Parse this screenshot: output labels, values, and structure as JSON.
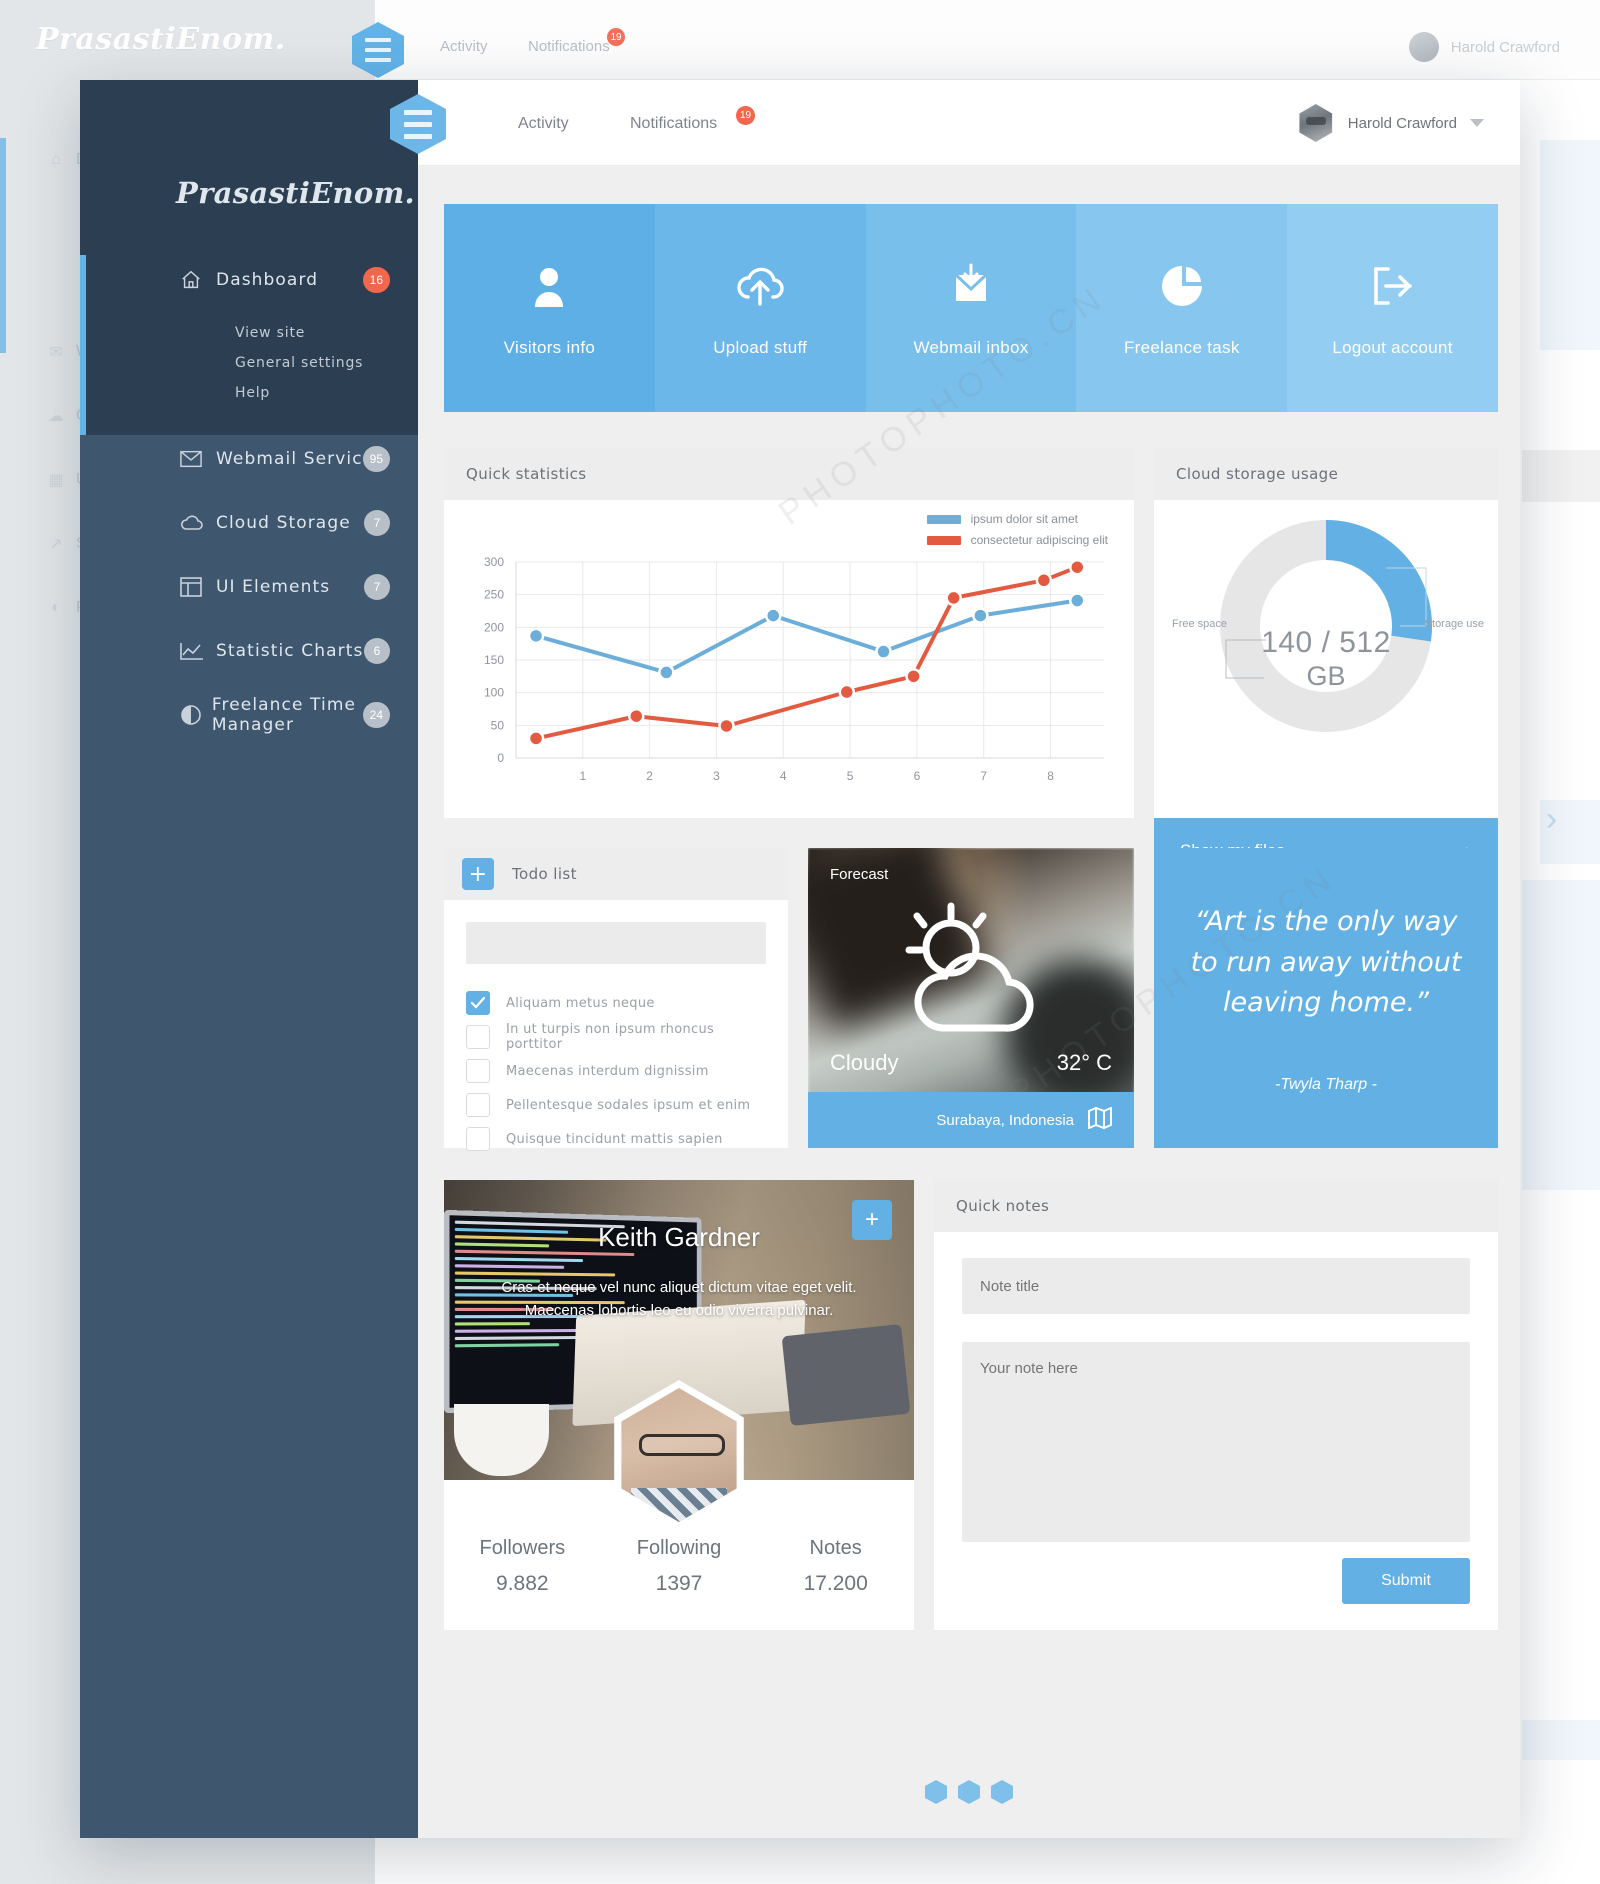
{
  "brand": {
    "logo": "PrasastiEnom."
  },
  "topbar": {
    "menu_toggle_icon": "hamburger-icon",
    "links": [
      {
        "label": "Activity",
        "badge": null
      },
      {
        "label": "Notifications",
        "badge": "19"
      }
    ],
    "user": {
      "name": "Harold Crawford",
      "caret_icon": "chevron-down-icon"
    }
  },
  "sidebar": {
    "items": [
      {
        "label": "Dashboard",
        "icon": "home-icon",
        "badge": "16",
        "badge_accent": true
      },
      {
        "label": "Webmail Service",
        "icon": "envelope-icon",
        "badge": "95",
        "badge_accent": false
      },
      {
        "label": "Cloud Storage",
        "icon": "cloud-icon",
        "badge": "7",
        "badge_accent": false
      },
      {
        "label": "UI Elements",
        "icon": "window-icon",
        "badge": "7",
        "badge_accent": false
      },
      {
        "label": "Statistic Charts",
        "icon": "line-chart-icon",
        "badge": "6",
        "badge_accent": false
      },
      {
        "label": "Freelance Time Manager",
        "icon": "pie-chart-icon",
        "badge": "24",
        "badge_accent": false
      }
    ],
    "sub_items": [
      {
        "label": "View site"
      },
      {
        "label": "General settings"
      },
      {
        "label": "Help"
      }
    ]
  },
  "tiles": [
    {
      "label": "Visitors info",
      "icon": "user-icon",
      "color": "#5dafe6"
    },
    {
      "label": "Upload stuff",
      "icon": "cloud-upload-icon",
      "color": "#6cb7e9"
    },
    {
      "label": "Webmail inbox",
      "icon": "mail-download-icon",
      "color": "#79bfec"
    },
    {
      "label": "Freelance task",
      "icon": "pie-chart-icon",
      "color": "#87c7ef"
    },
    {
      "label": "Logout account",
      "icon": "logout-icon",
      "color": "#93cdf1"
    }
  ],
  "quick_statistics": {
    "title": "Quick statistics"
  },
  "cloud_storage": {
    "title": "Cloud storage usage",
    "used_label": "140 / 512",
    "unit": "GB",
    "free_space_label": "Free space",
    "storage_use_label": "Storage use",
    "cta": "Show my files",
    "cta_icon": "chevron-right-icon"
  },
  "todo": {
    "title": "Todo list",
    "add_icon": "plus-icon",
    "input_value": "",
    "input_placeholder": "",
    "items": [
      {
        "text": "Aliquam metus neque",
        "done": true
      },
      {
        "text": "In ut turpis non ipsum rhoncus porttitor",
        "done": false
      },
      {
        "text": "Maecenas interdum dignissim",
        "done": false
      },
      {
        "text": "Pellentesque sodales ipsum et enim",
        "done": false
      },
      {
        "text": "Quisque tincidunt mattis sapien",
        "done": false
      }
    ]
  },
  "weather": {
    "label": "Forecast",
    "condition": "Cloudy",
    "temperature": "32° C",
    "location": "Surabaya, Indonesia",
    "map_icon": "map-icon",
    "icon": "sun-behind-cloud-icon"
  },
  "quote": {
    "text": "“Art is the only way to run away without leaving home.”",
    "author": "-Twyla Tharp -"
  },
  "profile": {
    "name": "Keith Gardner",
    "description": "Cras et neque vel nunc aliquet dictum vitae eget velit. Maecenas lobortis leo eu odio viverra pulvinar.",
    "add_icon": "plus-icon",
    "stats": [
      {
        "key": "Followers",
        "value": "9.882"
      },
      {
        "key": "Following",
        "value": "1397"
      },
      {
        "key": "Notes",
        "value": "17.200"
      }
    ]
  },
  "quick_notes": {
    "title": "Quick notes",
    "title_input_value": "",
    "title_placeholder": "Note title",
    "body_value": "",
    "body_placeholder": "Your note here",
    "submit_label": "Submit"
  },
  "pager": {
    "dots": 3,
    "active": 0
  },
  "colors": {
    "accent": "#62b0e4",
    "sidebar_dark": "#2c3e52",
    "sidebar": "#3f566f",
    "danger": "#f2674c",
    "series_blue": "#6caed9",
    "series_red": "#e25b41"
  },
  "chart_data": {
    "type": "line",
    "title": "Quick statistics",
    "xlabel": "",
    "ylabel": "",
    "x": [
      1,
      2,
      3,
      4,
      5,
      6,
      7,
      8
    ],
    "xticks": [
      "1",
      "2",
      "3",
      "4",
      "5",
      "6",
      "7",
      "8"
    ],
    "yticks": [
      "0",
      "50",
      "100",
      "150",
      "200",
      "250",
      "300"
    ],
    "ylim": [
      0,
      300
    ],
    "grid": true,
    "legend_position": "top-right",
    "series": [
      {
        "name": "ipsum dolor sit amet",
        "color": "#6caed9",
        "values": [
          187,
          131,
          null,
          218,
          null,
          163,
          218,
          241
        ]
      },
      {
        "name": "consectetur adipiscing elit",
        "color": "#e25b41",
        "values": [
          30,
          64,
          49,
          null,
          101,
          125,
          245,
          272
        ]
      }
    ],
    "series_points": [
      {
        "name": "ipsum dolor sit amet",
        "color": "#6caed9",
        "points": [
          [
            0.3,
            187
          ],
          [
            2.25,
            131
          ],
          [
            3.85,
            218
          ],
          [
            5.5,
            163
          ],
          [
            6.95,
            218
          ],
          [
            8.4,
            241
          ]
        ]
      },
      {
        "name": "consectetur adipiscing elit",
        "color": "#e25b41",
        "points": [
          [
            0.3,
            30
          ],
          [
            1.8,
            64
          ],
          [
            3.15,
            49
          ],
          [
            4.95,
            101
          ],
          [
            5.95,
            125
          ],
          [
            6.55,
            245
          ],
          [
            7.9,
            272
          ],
          [
            8.4,
            292
          ]
        ]
      }
    ]
  },
  "donut_data": {
    "type": "pie",
    "title": "Cloud storage usage",
    "labels": [
      "Storage use",
      "Free space"
    ],
    "values": [
      140,
      372
    ],
    "total": 512,
    "unit": "GB",
    "colors": [
      "#62b0e4",
      "#e6e6e6"
    ]
  }
}
